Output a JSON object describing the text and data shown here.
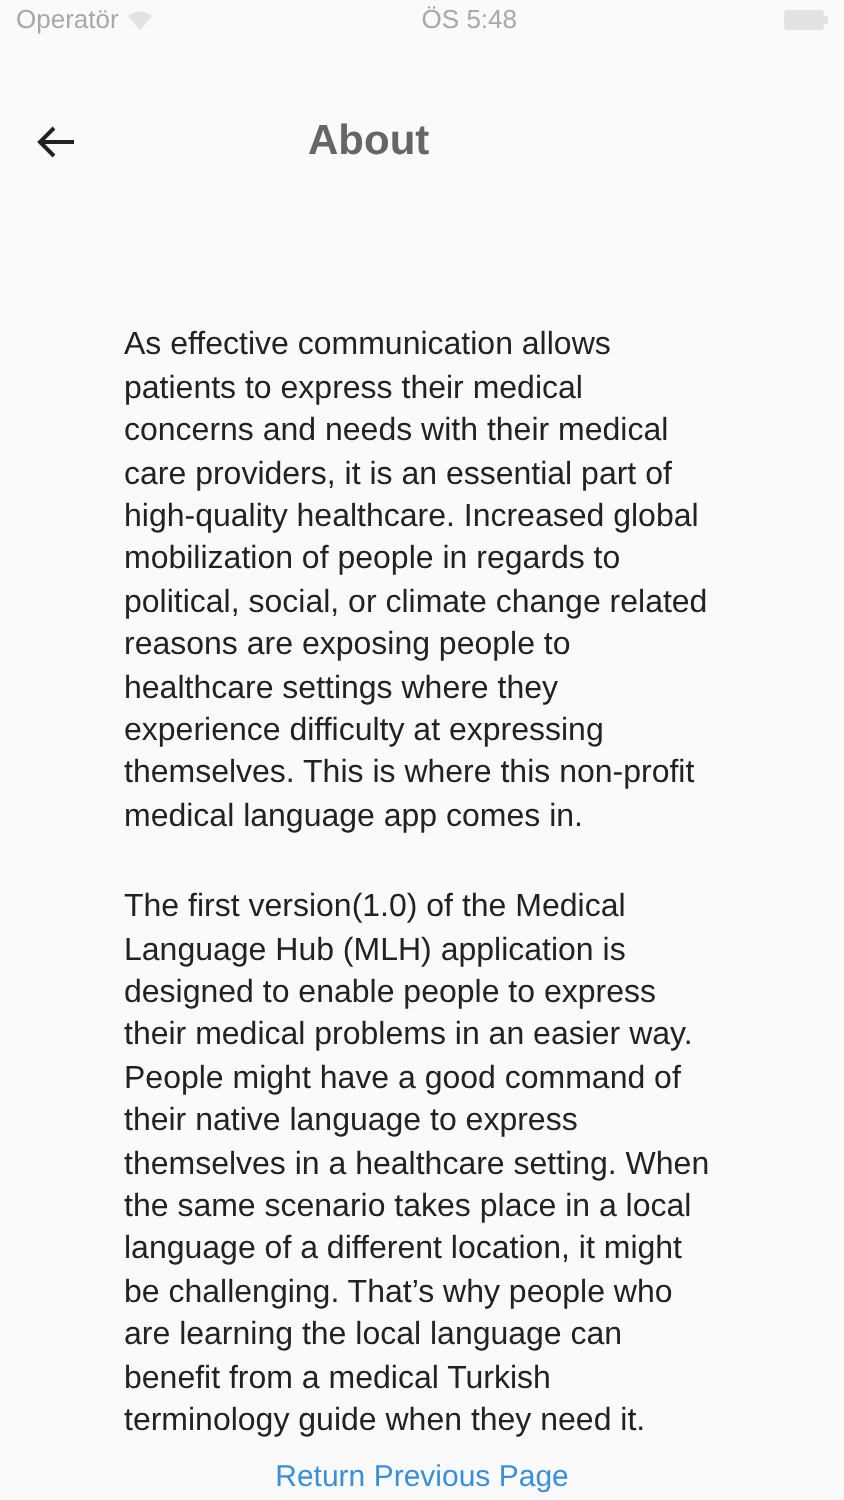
{
  "status_bar": {
    "carrier": "Operatör",
    "time": "ÖS 5:48"
  },
  "header": {
    "title": "About"
  },
  "paragraphs": [
    "As effective communication allows patients to express their medical concerns and needs with their medical care providers, it is an essential part of high-quality healthcare. Increased global mobilization of people in regards to political, social, or climate change related reasons are exposing people to healthcare settings where they experience difficulty at expressing themselves. This is where this non-profit medical language app comes in.",
    "The first version(1.0) of the Medical Language Hub (MLH) application is designed to enable people to express their medical problems in an easier way. People might have a good command of their native language to express themselves in a healthcare setting. When the same scenario takes place in a local language of a different location, it might be challenging. That’s why people who are learning the local language can benefit from a medical Turkish terminology guide when they need it."
  ],
  "link": "Return Previous Page"
}
